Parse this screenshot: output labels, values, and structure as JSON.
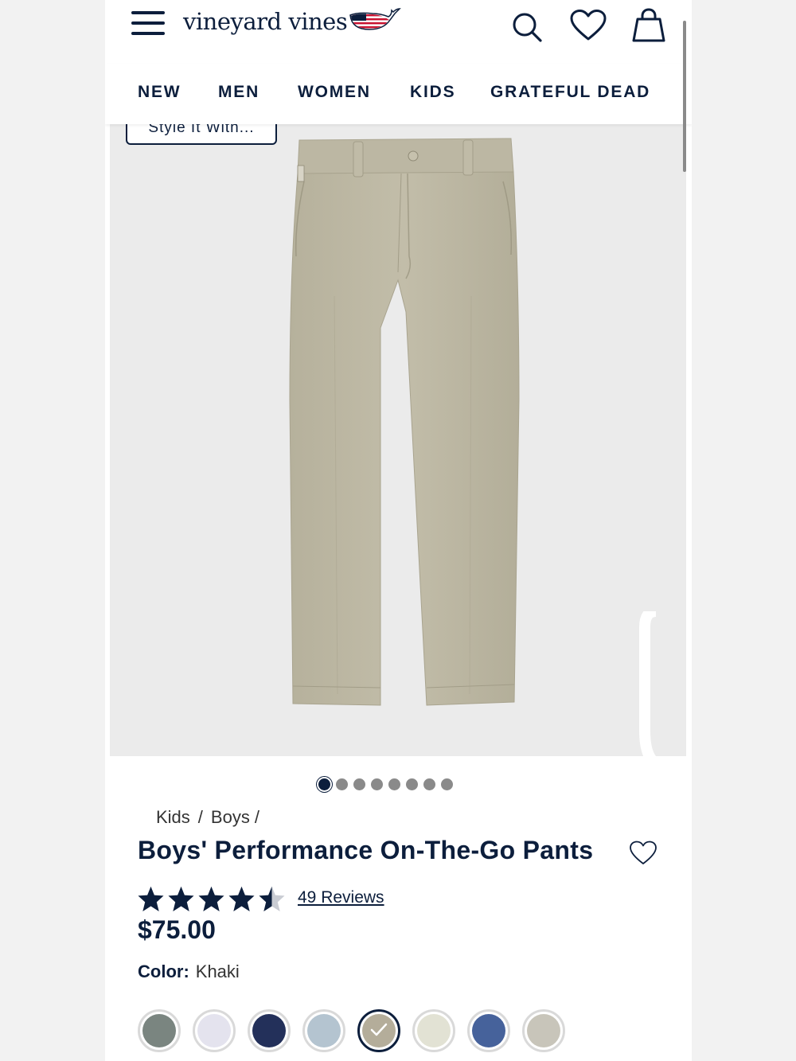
{
  "header": {
    "logo_text": "vineyard vines",
    "nav": [
      "NEW",
      "MEN",
      "WOMEN",
      "KIDS",
      "GRATEFUL DEAD"
    ]
  },
  "hero": {
    "style_button": "Style It With...",
    "slides_total": 8,
    "active_slide": 1
  },
  "breadcrumb": [
    "Kids",
    "Boys"
  ],
  "product": {
    "title": "Boys' Performance On-The-Go Pants",
    "rating": 4.5,
    "reviews_label": "49 Reviews",
    "price": "$75.00",
    "color_label": "Color:",
    "color_value": "Khaki"
  },
  "swatches": [
    {
      "color": "#7a8580",
      "selected": false
    },
    {
      "color": "#e4e3ee",
      "selected": false
    },
    {
      "color": "#23305a",
      "selected": false
    },
    {
      "color": "#b4c4d0",
      "selected": false
    },
    {
      "color": "#b4ad9a",
      "selected": true
    },
    {
      "color": "#e2e2d4",
      "selected": false
    },
    {
      "color": "#46629b",
      "selected": false
    },
    {
      "color": "#c8c5ba",
      "selected": false
    }
  ],
  "colors": {
    "navy": "#0c1e3c",
    "pants": "#bcb7a3"
  }
}
